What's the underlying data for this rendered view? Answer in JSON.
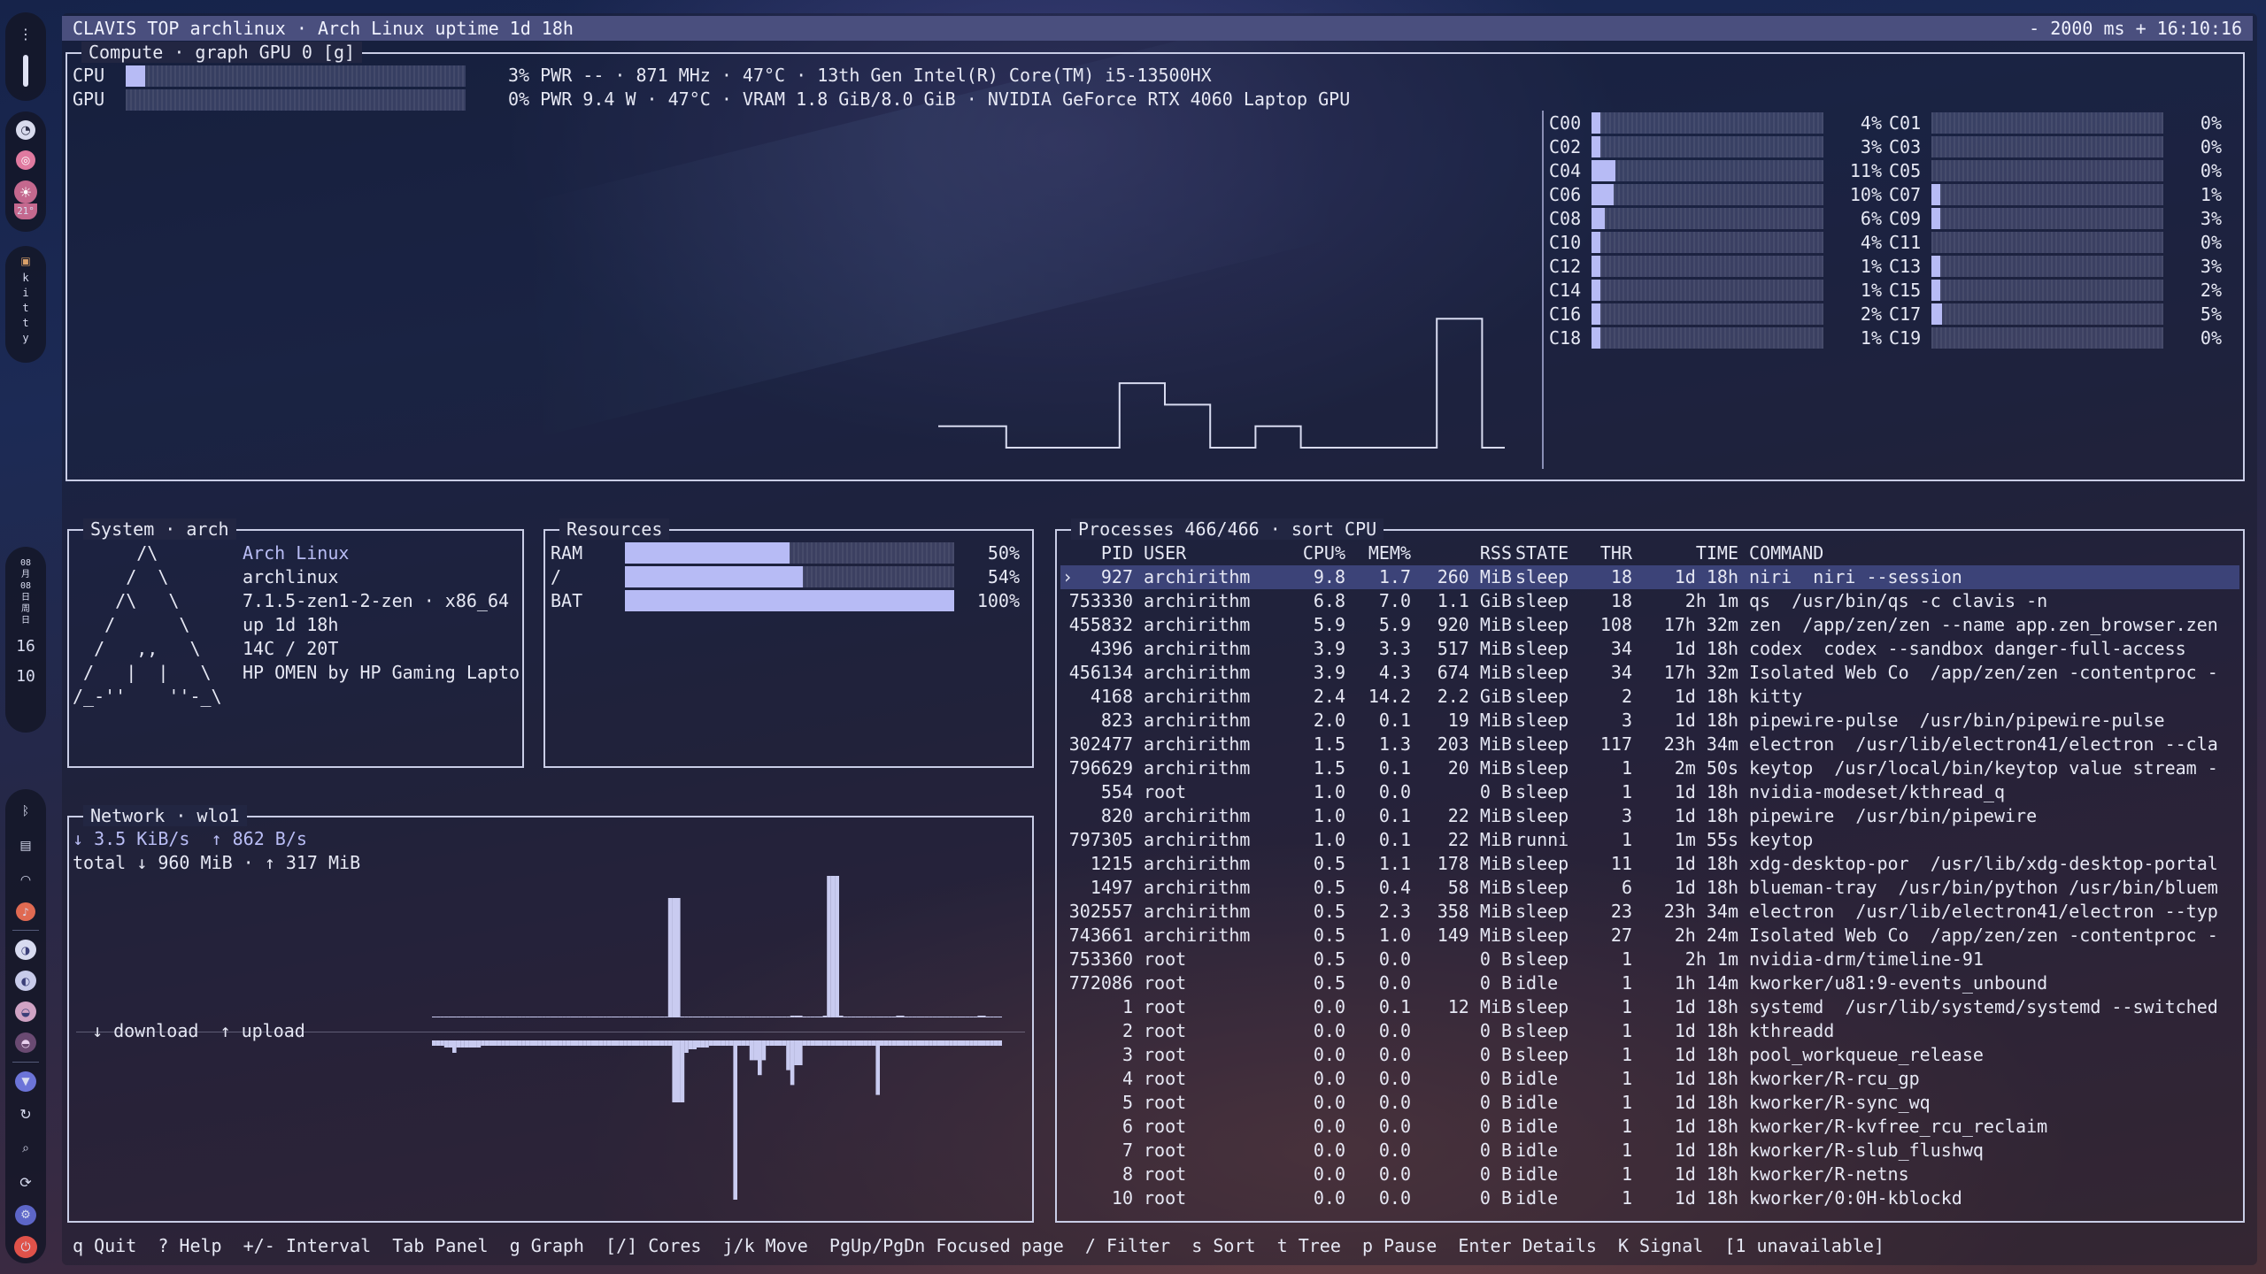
{
  "topbar": {
    "left": "CLAVIS TOP  archlinux · Arch Linux  uptime 1d 18h",
    "right": "- 2000 ms +  16:10:16"
  },
  "dock": {
    "weather_temp": "21°",
    "app_vertical": [
      "k",
      "i",
      "t",
      "t",
      "y"
    ],
    "date_vertical": [
      "08",
      "月",
      "08",
      "日",
      "周",
      "日"
    ],
    "hour": "16",
    "minute": "10"
  },
  "compute": {
    "title": "Compute · graph GPU 0 [g]",
    "cpu": {
      "label": "CPU",
      "percent": 3,
      "text": "3% PWR -- · 871 MHz · 47°C · 13th Gen Intel(R) Core(TM) i5-13500HX"
    },
    "gpu": {
      "label": "GPU",
      "percent": 0,
      "text": "0% PWR 9.4 W · 47°C · VRAM 1.8 GiB/8.0 GiB · NVIDIA GeForce RTX 4060 Laptop GPU"
    },
    "cores": [
      {
        "name": "C00",
        "pct": 4,
        "label": "4%"
      },
      {
        "name": "C01",
        "pct": 0,
        "label": "0%"
      },
      {
        "name": "C02",
        "pct": 3,
        "label": "3%"
      },
      {
        "name": "C03",
        "pct": 0,
        "label": "0%"
      },
      {
        "name": "C04",
        "pct": 11,
        "label": "11%"
      },
      {
        "name": "C05",
        "pct": 0,
        "label": "0%"
      },
      {
        "name": "C06",
        "pct": 10,
        "label": "10%"
      },
      {
        "name": "C07",
        "pct": 1,
        "label": "1%"
      },
      {
        "name": "C08",
        "pct": 6,
        "label": "6%"
      },
      {
        "name": "C09",
        "pct": 3,
        "label": "3%"
      },
      {
        "name": "C10",
        "pct": 4,
        "label": "4%"
      },
      {
        "name": "C11",
        "pct": 0,
        "label": "0%"
      },
      {
        "name": "C12",
        "pct": 1,
        "label": "1%"
      },
      {
        "name": "C13",
        "pct": 3,
        "label": "3%"
      },
      {
        "name": "C14",
        "pct": 1,
        "label": "1%"
      },
      {
        "name": "C15",
        "pct": 2,
        "label": "2%"
      },
      {
        "name": "C16",
        "pct": 2,
        "label": "2%"
      },
      {
        "name": "C17",
        "pct": 5,
        "label": "5%"
      },
      {
        "name": "C18",
        "pct": 1,
        "label": "1%"
      },
      {
        "name": "C19",
        "pct": 0,
        "label": "0%"
      }
    ],
    "gpu_history": [
      1,
      1,
      1,
      0,
      0,
      0,
      0,
      0,
      3,
      3,
      2,
      2,
      0,
      0,
      1,
      1,
      0,
      0,
      0,
      0,
      0,
      0,
      6,
      6,
      0
    ]
  },
  "system": {
    "title": "System · arch",
    "logo": [
      "      /\\",
      "     /  \\",
      "    /\\   \\",
      "   /      \\",
      "  /   ,,   \\",
      " /   |  |   \\",
      "/_-''    ''-_\\"
    ],
    "lines": [
      "Arch Linux",
      "archlinux",
      "7.1.5-zen1-2-zen · x86_64",
      "up 1d 18h",
      "14C / 20T",
      "HP OMEN by HP Gaming Lapto"
    ]
  },
  "resources": {
    "title": "Resources",
    "items": [
      {
        "label": "RAM",
        "pct": 50,
        "text": "50%"
      },
      {
        "label": "/",
        "pct": 54,
        "text": "54%"
      },
      {
        "label": "BAT",
        "pct": 100,
        "text": "100%"
      }
    ]
  },
  "network": {
    "title": "Network · wlo1",
    "rate": "↓ 3.5 KiB/s  ↑ 862 B/s",
    "total": "total ↓ 960 MiB · ↑ 317 MiB",
    "legend": "↓ download  ↑ upload",
    "download": [
      1,
      1,
      1,
      1,
      1,
      1,
      1,
      1,
      1,
      1,
      1,
      1,
      1,
      1,
      1,
      1,
      1,
      1,
      1,
      1,
      1,
      1,
      1,
      1,
      1,
      1,
      1,
      1,
      1,
      1,
      1,
      1,
      1,
      1,
      1,
      1,
      1,
      1,
      1,
      1,
      1,
      1,
      1,
      1,
      1,
      1,
      1,
      1,
      1,
      1,
      1,
      1,
      1,
      1,
      1,
      1,
      1,
      1,
      20,
      22,
      22,
      1,
      1,
      1,
      1,
      1,
      1,
      1,
      1,
      1,
      1,
      1,
      1,
      1,
      1,
      1,
      1,
      1,
      1,
      1,
      1,
      1,
      1,
      1,
      1,
      1,
      1,
      1,
      2,
      2,
      2,
      1,
      1,
      1,
      1,
      1,
      2,
      28,
      28,
      2,
      2,
      1,
      1,
      1,
      1,
      1,
      1,
      1,
      1,
      1,
      1,
      1,
      1,
      1,
      2,
      2,
      1,
      1,
      1,
      1,
      1,
      1,
      1,
      1,
      1,
      1,
      1,
      1,
      1,
      1,
      1,
      1,
      1,
      1,
      2,
      2,
      1,
      1,
      1,
      1
    ],
    "upload": [
      6,
      6,
      6,
      8,
      8,
      14,
      8,
      8,
      8,
      8,
      8,
      8,
      6,
      6,
      6,
      6,
      6,
      6,
      6,
      6,
      6,
      6,
      6,
      6,
      6,
      6,
      6,
      6,
      6,
      6,
      6,
      6,
      6,
      6,
      6,
      6,
      6,
      6,
      6,
      6,
      6,
      6,
      6,
      6,
      6,
      6,
      6,
      6,
      6,
      6,
      6,
      6,
      6,
      6,
      6,
      6,
      6,
      6,
      6,
      28,
      28,
      28,
      14,
      10,
      10,
      8,
      8,
      8,
      6,
      6,
      6,
      6,
      6,
      6,
      6,
      6,
      6,
      6,
      6,
      6,
      6,
      6,
      6,
      6,
      6,
      6,
      6,
      6,
      6,
      6,
      6,
      6,
      6,
      6,
      6,
      6,
      6,
      6,
      6,
      6,
      6,
      6,
      6,
      6,
      6,
      6,
      6,
      6,
      6,
      6,
      6,
      6,
      6,
      6,
      6,
      6,
      6,
      6,
      6,
      6,
      6,
      6,
      6,
      6,
      6,
      6,
      6,
      6,
      6,
      6,
      6,
      6,
      6,
      6,
      6,
      6,
      6,
      6,
      6,
      6
    ],
    "upload_spikes": {
      "74": 70,
      "78": 8,
      "79": 8,
      "80": 14,
      "81": 8,
      "87": 12,
      "88": 18,
      "89": 10,
      "90": 10,
      "109": 22
    }
  },
  "processes": {
    "title": "Processes 466/466 · sort CPU",
    "headers": [
      "PID",
      "USER",
      "CPU%",
      "MEM%",
      "RSS",
      "STATE",
      "THR",
      "TIME",
      "COMMAND"
    ],
    "selector": "›",
    "rows": [
      [
        "927",
        "archirithm",
        "9.8",
        "1.7",
        "260 MiB",
        "sleep",
        "18",
        "1d 18h",
        "niri  niri --session"
      ],
      [
        "753330",
        "archirithm",
        "6.8",
        "7.0",
        "1.1 GiB",
        "sleep",
        "18",
        "2h 1m",
        "qs  /usr/bin/qs -c clavis -n"
      ],
      [
        "455832",
        "archirithm",
        "5.9",
        "5.9",
        "920 MiB",
        "sleep",
        "108",
        "17h 32m",
        "zen  /app/zen/zen --name app.zen_browser.zen"
      ],
      [
        "4396",
        "archirithm",
        "3.9",
        "3.3",
        "517 MiB",
        "sleep",
        "34",
        "1d 18h",
        "codex  codex --sandbox danger-full-access"
      ],
      [
        "456134",
        "archirithm",
        "3.9",
        "4.3",
        "674 MiB",
        "sleep",
        "34",
        "17h 32m",
        "Isolated Web Co  /app/zen/zen -contentproc -"
      ],
      [
        "4168",
        "archirithm",
        "2.4",
        "14.2",
        "2.2 GiB",
        "sleep",
        "2",
        "1d 18h",
        "kitty"
      ],
      [
        "823",
        "archirithm",
        "2.0",
        "0.1",
        "19 MiB",
        "sleep",
        "3",
        "1d 18h",
        "pipewire-pulse  /usr/bin/pipewire-pulse"
      ],
      [
        "302477",
        "archirithm",
        "1.5",
        "1.3",
        "203 MiB",
        "sleep",
        "117",
        "23h 34m",
        "electron  /usr/lib/electron41/electron --cla"
      ],
      [
        "796629",
        "archirithm",
        "1.5",
        "0.1",
        "20 MiB",
        "sleep",
        "1",
        "2m 50s",
        "keytop  /usr/local/bin/keytop value stream -"
      ],
      [
        "554",
        "root",
        "1.0",
        "0.0",
        "0 B",
        "sleep",
        "1",
        "1d 18h",
        "nvidia-modeset/kthread_q"
      ],
      [
        "820",
        "archirithm",
        "1.0",
        "0.1",
        "22 MiB",
        "sleep",
        "3",
        "1d 18h",
        "pipewire  /usr/bin/pipewire"
      ],
      [
        "797305",
        "archirithm",
        "1.0",
        "0.1",
        "22 MiB",
        "runni",
        "1",
        "1m 55s",
        "keytop"
      ],
      [
        "1215",
        "archirithm",
        "0.5",
        "1.1",
        "178 MiB",
        "sleep",
        "11",
        "1d 18h",
        "xdg-desktop-por  /usr/lib/xdg-desktop-portal"
      ],
      [
        "1497",
        "archirithm",
        "0.5",
        "0.4",
        "58 MiB",
        "sleep",
        "6",
        "1d 18h",
        "blueman-tray  /usr/bin/python /usr/bin/bluem"
      ],
      [
        "302557",
        "archirithm",
        "0.5",
        "2.3",
        "358 MiB",
        "sleep",
        "23",
        "23h 34m",
        "electron  /usr/lib/electron41/electron --typ"
      ],
      [
        "743661",
        "archirithm",
        "0.5",
        "1.0",
        "149 MiB",
        "sleep",
        "27",
        "2h 24m",
        "Isolated Web Co  /app/zen/zen -contentproc -"
      ],
      [
        "753360",
        "root",
        "0.5",
        "0.0",
        "0 B",
        "sleep",
        "1",
        "2h 1m",
        "nvidia-drm/timeline-91"
      ],
      [
        "772086",
        "root",
        "0.5",
        "0.0",
        "0 B",
        "idle",
        "1",
        "1h 14m",
        "kworker/u81:9-events_unbound"
      ],
      [
        "1",
        "root",
        "0.0",
        "0.1",
        "12 MiB",
        "sleep",
        "1",
        "1d 18h",
        "systemd  /usr/lib/systemd/systemd --switched"
      ],
      [
        "2",
        "root",
        "0.0",
        "0.0",
        "0 B",
        "sleep",
        "1",
        "1d 18h",
        "kthreadd"
      ],
      [
        "3",
        "root",
        "0.0",
        "0.0",
        "0 B",
        "sleep",
        "1",
        "1d 18h",
        "pool_workqueue_release"
      ],
      [
        "4",
        "root",
        "0.0",
        "0.0",
        "0 B",
        "idle",
        "1",
        "1d 18h",
        "kworker/R-rcu_gp"
      ],
      [
        "5",
        "root",
        "0.0",
        "0.0",
        "0 B",
        "idle",
        "1",
        "1d 18h",
        "kworker/R-sync_wq"
      ],
      [
        "6",
        "root",
        "0.0",
        "0.0",
        "0 B",
        "idle",
        "1",
        "1d 18h",
        "kworker/R-kvfree_rcu_reclaim"
      ],
      [
        "7",
        "root",
        "0.0",
        "0.0",
        "0 B",
        "idle",
        "1",
        "1d 18h",
        "kworker/R-slub_flushwq"
      ],
      [
        "8",
        "root",
        "0.0",
        "0.0",
        "0 B",
        "idle",
        "1",
        "1d 18h",
        "kworker/R-netns"
      ],
      [
        "10",
        "root",
        "0.0",
        "0.0",
        "0 B",
        "idle",
        "1",
        "1d 18h",
        "kworker/0:0H-kblockd"
      ]
    ]
  },
  "footer": "q Quit  ? Help  +/- Interval  Tab Panel  g Graph  [/] Cores  j/k Move  PgUp/PgDn Focused page  / Filter  s Sort  t Tree  p Pause  Enter Details  K Signal  [1 unavailable]",
  "colors": {
    "accent": "#b7bbf5",
    "topbar": "#4a4f7e",
    "selection": "#3c4378",
    "border": "#c9cde6"
  }
}
